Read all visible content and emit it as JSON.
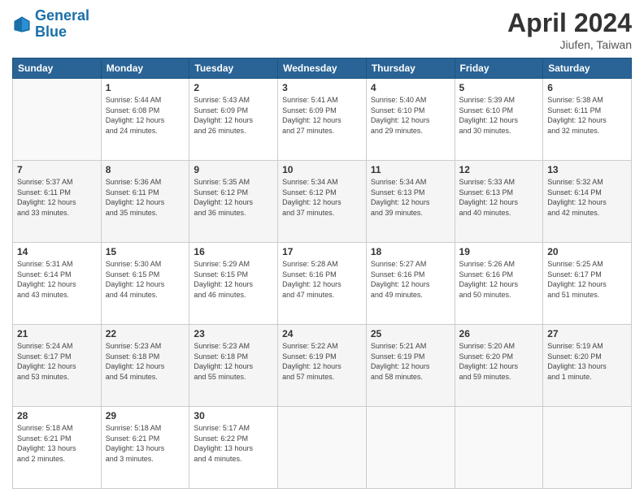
{
  "header": {
    "logo_line1": "General",
    "logo_line2": "Blue",
    "month": "April 2024",
    "location": "Jiufen, Taiwan"
  },
  "weekdays": [
    "Sunday",
    "Monday",
    "Tuesday",
    "Wednesday",
    "Thursday",
    "Friday",
    "Saturday"
  ],
  "weeks": [
    [
      {
        "day": "",
        "info": ""
      },
      {
        "day": "1",
        "info": "Sunrise: 5:44 AM\nSunset: 6:08 PM\nDaylight: 12 hours\nand 24 minutes."
      },
      {
        "day": "2",
        "info": "Sunrise: 5:43 AM\nSunset: 6:09 PM\nDaylight: 12 hours\nand 26 minutes."
      },
      {
        "day": "3",
        "info": "Sunrise: 5:41 AM\nSunset: 6:09 PM\nDaylight: 12 hours\nand 27 minutes."
      },
      {
        "day": "4",
        "info": "Sunrise: 5:40 AM\nSunset: 6:10 PM\nDaylight: 12 hours\nand 29 minutes."
      },
      {
        "day": "5",
        "info": "Sunrise: 5:39 AM\nSunset: 6:10 PM\nDaylight: 12 hours\nand 30 minutes."
      },
      {
        "day": "6",
        "info": "Sunrise: 5:38 AM\nSunset: 6:11 PM\nDaylight: 12 hours\nand 32 minutes."
      }
    ],
    [
      {
        "day": "7",
        "info": "Sunrise: 5:37 AM\nSunset: 6:11 PM\nDaylight: 12 hours\nand 33 minutes."
      },
      {
        "day": "8",
        "info": "Sunrise: 5:36 AM\nSunset: 6:11 PM\nDaylight: 12 hours\nand 35 minutes."
      },
      {
        "day": "9",
        "info": "Sunrise: 5:35 AM\nSunset: 6:12 PM\nDaylight: 12 hours\nand 36 minutes."
      },
      {
        "day": "10",
        "info": "Sunrise: 5:34 AM\nSunset: 6:12 PM\nDaylight: 12 hours\nand 37 minutes."
      },
      {
        "day": "11",
        "info": "Sunrise: 5:34 AM\nSunset: 6:13 PM\nDaylight: 12 hours\nand 39 minutes."
      },
      {
        "day": "12",
        "info": "Sunrise: 5:33 AM\nSunset: 6:13 PM\nDaylight: 12 hours\nand 40 minutes."
      },
      {
        "day": "13",
        "info": "Sunrise: 5:32 AM\nSunset: 6:14 PM\nDaylight: 12 hours\nand 42 minutes."
      }
    ],
    [
      {
        "day": "14",
        "info": "Sunrise: 5:31 AM\nSunset: 6:14 PM\nDaylight: 12 hours\nand 43 minutes."
      },
      {
        "day": "15",
        "info": "Sunrise: 5:30 AM\nSunset: 6:15 PM\nDaylight: 12 hours\nand 44 minutes."
      },
      {
        "day": "16",
        "info": "Sunrise: 5:29 AM\nSunset: 6:15 PM\nDaylight: 12 hours\nand 46 minutes."
      },
      {
        "day": "17",
        "info": "Sunrise: 5:28 AM\nSunset: 6:16 PM\nDaylight: 12 hours\nand 47 minutes."
      },
      {
        "day": "18",
        "info": "Sunrise: 5:27 AM\nSunset: 6:16 PM\nDaylight: 12 hours\nand 49 minutes."
      },
      {
        "day": "19",
        "info": "Sunrise: 5:26 AM\nSunset: 6:16 PM\nDaylight: 12 hours\nand 50 minutes."
      },
      {
        "day": "20",
        "info": "Sunrise: 5:25 AM\nSunset: 6:17 PM\nDaylight: 12 hours\nand 51 minutes."
      }
    ],
    [
      {
        "day": "21",
        "info": "Sunrise: 5:24 AM\nSunset: 6:17 PM\nDaylight: 12 hours\nand 53 minutes."
      },
      {
        "day": "22",
        "info": "Sunrise: 5:23 AM\nSunset: 6:18 PM\nDaylight: 12 hours\nand 54 minutes."
      },
      {
        "day": "23",
        "info": "Sunrise: 5:23 AM\nSunset: 6:18 PM\nDaylight: 12 hours\nand 55 minutes."
      },
      {
        "day": "24",
        "info": "Sunrise: 5:22 AM\nSunset: 6:19 PM\nDaylight: 12 hours\nand 57 minutes."
      },
      {
        "day": "25",
        "info": "Sunrise: 5:21 AM\nSunset: 6:19 PM\nDaylight: 12 hours\nand 58 minutes."
      },
      {
        "day": "26",
        "info": "Sunrise: 5:20 AM\nSunset: 6:20 PM\nDaylight: 12 hours\nand 59 minutes."
      },
      {
        "day": "27",
        "info": "Sunrise: 5:19 AM\nSunset: 6:20 PM\nDaylight: 13 hours\nand 1 minute."
      }
    ],
    [
      {
        "day": "28",
        "info": "Sunrise: 5:18 AM\nSunset: 6:21 PM\nDaylight: 13 hours\nand 2 minutes."
      },
      {
        "day": "29",
        "info": "Sunrise: 5:18 AM\nSunset: 6:21 PM\nDaylight: 13 hours\nand 3 minutes."
      },
      {
        "day": "30",
        "info": "Sunrise: 5:17 AM\nSunset: 6:22 PM\nDaylight: 13 hours\nand 4 minutes."
      },
      {
        "day": "",
        "info": ""
      },
      {
        "day": "",
        "info": ""
      },
      {
        "day": "",
        "info": ""
      },
      {
        "day": "",
        "info": ""
      }
    ]
  ]
}
